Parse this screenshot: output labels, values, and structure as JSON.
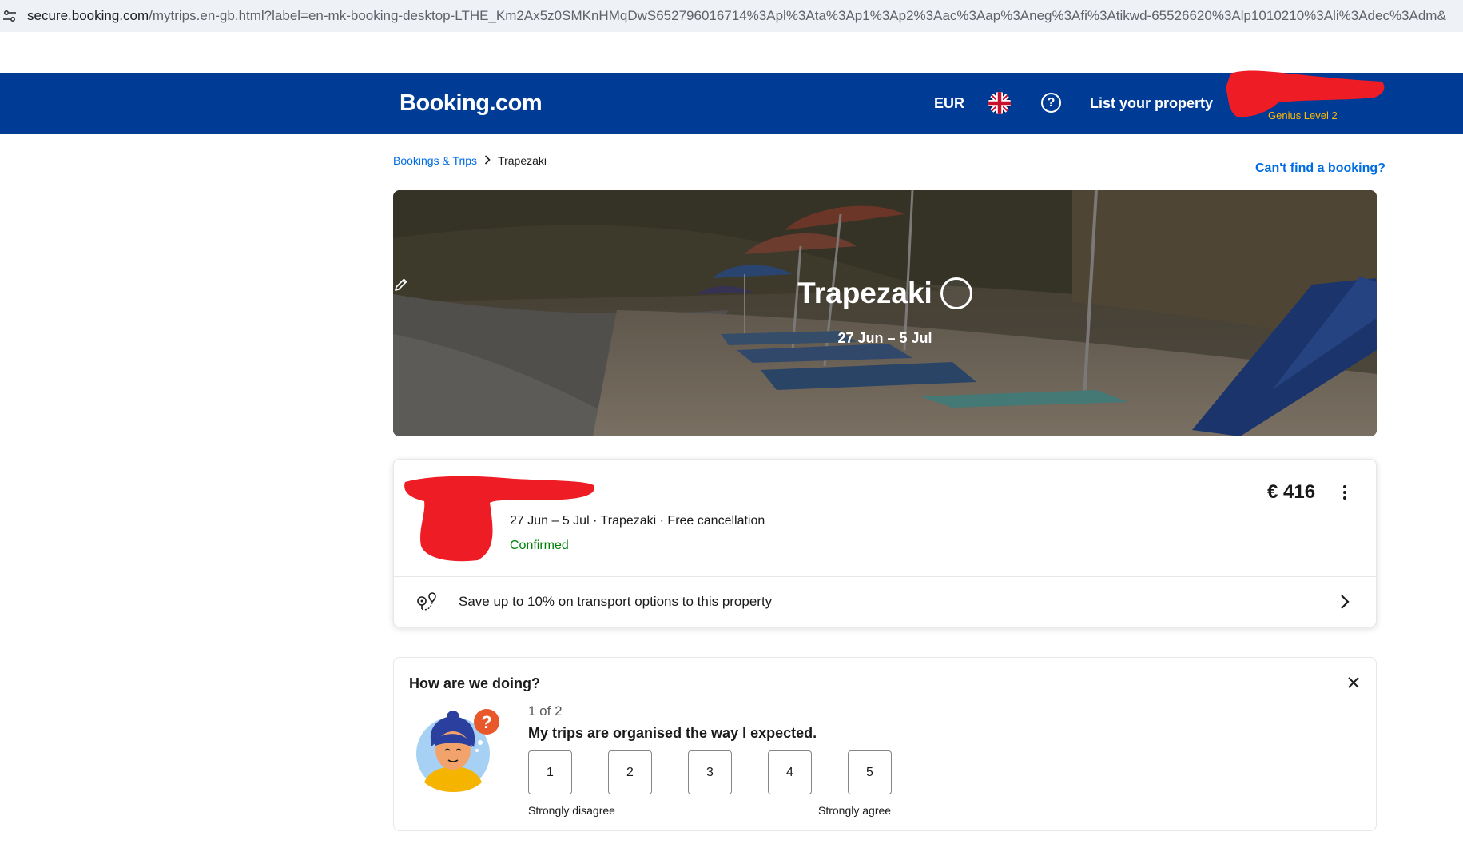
{
  "browser": {
    "url_host": "secure.booking.com",
    "url_path": "/mytrips.en-gb.html?label=en-mk-booking-desktop-LTHE_Km2Ax5z0SMKnHMqDwS652796016714%3Apl%3Ata%3Ap1%3Ap2%3Aac%3Aap%3Aneg%3Afi%3Atikwd-65526620%3Alp1010210%3Ali%3Adec%3Adm&"
  },
  "header": {
    "logo": "Booking.com",
    "currency": "EUR",
    "list_property": "List your property",
    "genius_level": "Genius Level 2",
    "colors": {
      "bg": "#003b95",
      "genius": "#febb02"
    }
  },
  "breadcrumb": {
    "parent": "Bookings & Trips",
    "current": "Trapezaki"
  },
  "cant_find_booking": "Can't find a booking?",
  "trip": {
    "title": "Trapezaki",
    "dates": "27 Jun – 5 Jul"
  },
  "booking": {
    "meta": "27 Jun – 5 Jul · Trapezaki · Free cancellation",
    "status": "Confirmed",
    "price": "€ 416",
    "transport_offer": "Save up to 10% on transport options to this property"
  },
  "feedback": {
    "title": "How are we doing?",
    "progress": "1 of 2",
    "question": "My trips are organised the way I expected.",
    "scale": [
      "1",
      "2",
      "3",
      "4",
      "5"
    ],
    "min_label": "Strongly disagree",
    "max_label": "Strongly agree"
  }
}
